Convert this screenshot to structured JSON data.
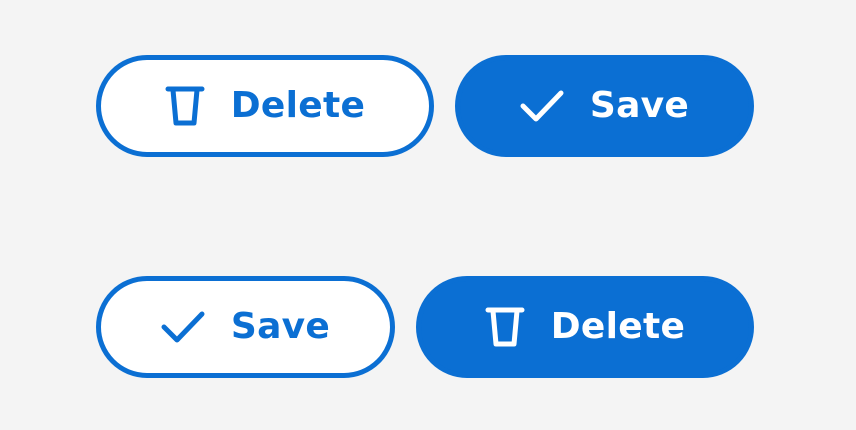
{
  "colors": {
    "background": "#f4f4f4",
    "accent": "#0b6fd3",
    "on_accent": "#ffffff"
  },
  "rows": [
    {
      "buttons": [
        {
          "label": "Delete",
          "icon": "trash-icon",
          "variant": "outline"
        },
        {
          "label": "Save",
          "icon": "check-icon",
          "variant": "filled"
        }
      ]
    },
    {
      "buttons": [
        {
          "label": "Save",
          "icon": "check-icon",
          "variant": "outline"
        },
        {
          "label": "Delete",
          "icon": "trash-icon",
          "variant": "filled"
        }
      ]
    }
  ]
}
